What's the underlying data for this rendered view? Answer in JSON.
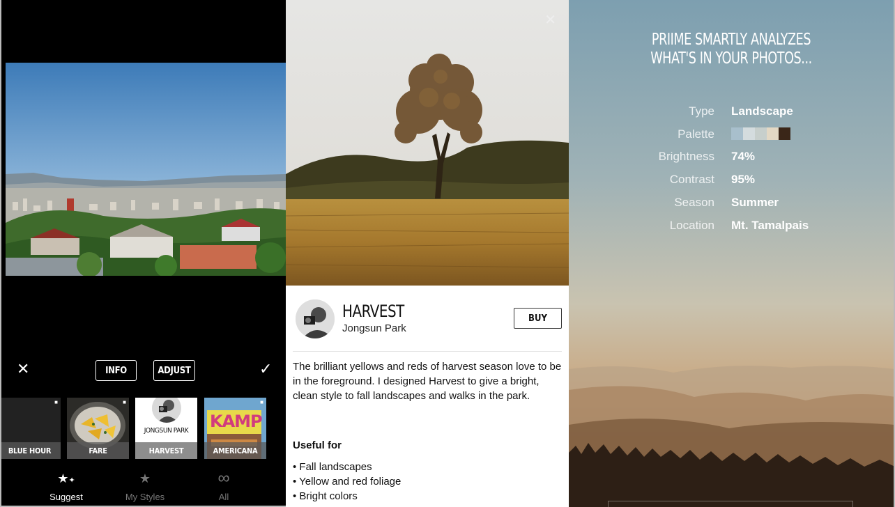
{
  "left_panel": {
    "toolbar": {
      "cancel_icon": "close-icon",
      "info_label": "INFO",
      "adjust_label": "ADJUST",
      "confirm_icon": "checkmark-icon"
    },
    "filters": [
      {
        "label": "BLUE HOUR",
        "locked": true,
        "selected": false
      },
      {
        "label": "FARE",
        "locked": true,
        "selected": false
      },
      {
        "label": "HARVEST",
        "author": "JONGSUN PARK",
        "locked": false,
        "selected": true
      },
      {
        "label": "AMERICANA",
        "sign_text": "KAMP",
        "locked": true,
        "selected": false
      }
    ],
    "bottom_nav": [
      {
        "label": "Suggest",
        "icon": "stars-icon",
        "active": true
      },
      {
        "label": "My Styles",
        "icon": "star-icon",
        "active": false
      },
      {
        "label": "All",
        "icon": "infinity-icon",
        "active": false
      }
    ]
  },
  "middle_panel": {
    "close_icon": "close-icon",
    "style_title": "HARVEST",
    "author": "Jongsun Park",
    "buy_label": "BUY",
    "description": "The brilliant yellows and reds of harvest season love to be in the foreground. I designed Harvest to give a bright, clean style to fall landscapes and walks in the park.",
    "useful_for_title": "Useful for",
    "useful_for": [
      "• Fall landscapes",
      "• Yellow and red foliage",
      "• Bright colors"
    ]
  },
  "right_panel": {
    "headline_line1": "PRIIME SMARTLY ANALYZES",
    "headline_line2": "WHAT'S IN YOUR PHOTOS...",
    "analysis": [
      {
        "key": "Type",
        "value": "Landscape"
      },
      {
        "key": "Palette",
        "value": "",
        "swatches": [
          "#a8bfcc",
          "#d4dcde",
          "#c7cfcc",
          "#e3d8c4",
          "#3a2618"
        ]
      },
      {
        "key": "Brightness",
        "value": "74%"
      },
      {
        "key": "Contrast",
        "value": "95%"
      },
      {
        "key": "Season",
        "value": "Summer"
      },
      {
        "key": "Location",
        "value": "Mt. Tamalpais"
      }
    ]
  }
}
